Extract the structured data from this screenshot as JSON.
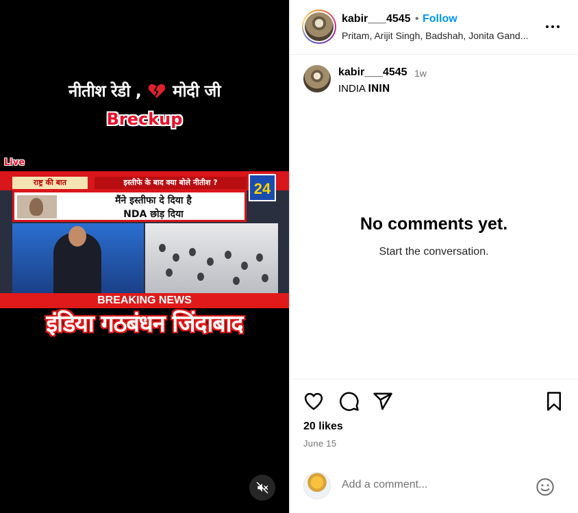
{
  "media": {
    "caption_line1_left": "नीतीश रेडी ,",
    "caption_line1_right": "मोदी जी",
    "caption_line2": "Breckup",
    "live_label": "Live",
    "news_topleft": "राष्ट्र की बात",
    "news_topright": "इस्तीफे के बाद क्या बोले नीतीश ?",
    "channel_logo": "24",
    "headline_line1": "मैंने इस्तीफा दे दिया है",
    "headline_line2": "NDA छोड़ दिया",
    "breaking": "BREAKING NEWS",
    "slogan": "इंडिया गठबंधन जिंदाबाद",
    "mute_icon": "speaker-muted-icon"
  },
  "header": {
    "username": "kabir___4545",
    "separator": "•",
    "follow_label": "Follow",
    "audio": "Pritam, Arijit Singh, Badshah, Jonita Gand...",
    "more_icon": "more-horizontal-icon"
  },
  "caption": {
    "username": "kabir___4545",
    "time": "1w",
    "text": "INDIA 𝐈𝐍𝐈𝐍"
  },
  "comments": {
    "empty_title": "No comments yet.",
    "empty_subtitle": "Start the conversation."
  },
  "actions": {
    "icons": [
      "heart-icon",
      "comment-icon",
      "share-icon",
      "bookmark-icon"
    ],
    "likes": "20 likes",
    "date": "June 15"
  },
  "composer": {
    "placeholder": "Add a comment...",
    "emoji_icon": "emoji-icon"
  },
  "colors": {
    "accent_blue": "#0095f6",
    "muted_text": "#737373",
    "news_red": "#d8161b"
  }
}
